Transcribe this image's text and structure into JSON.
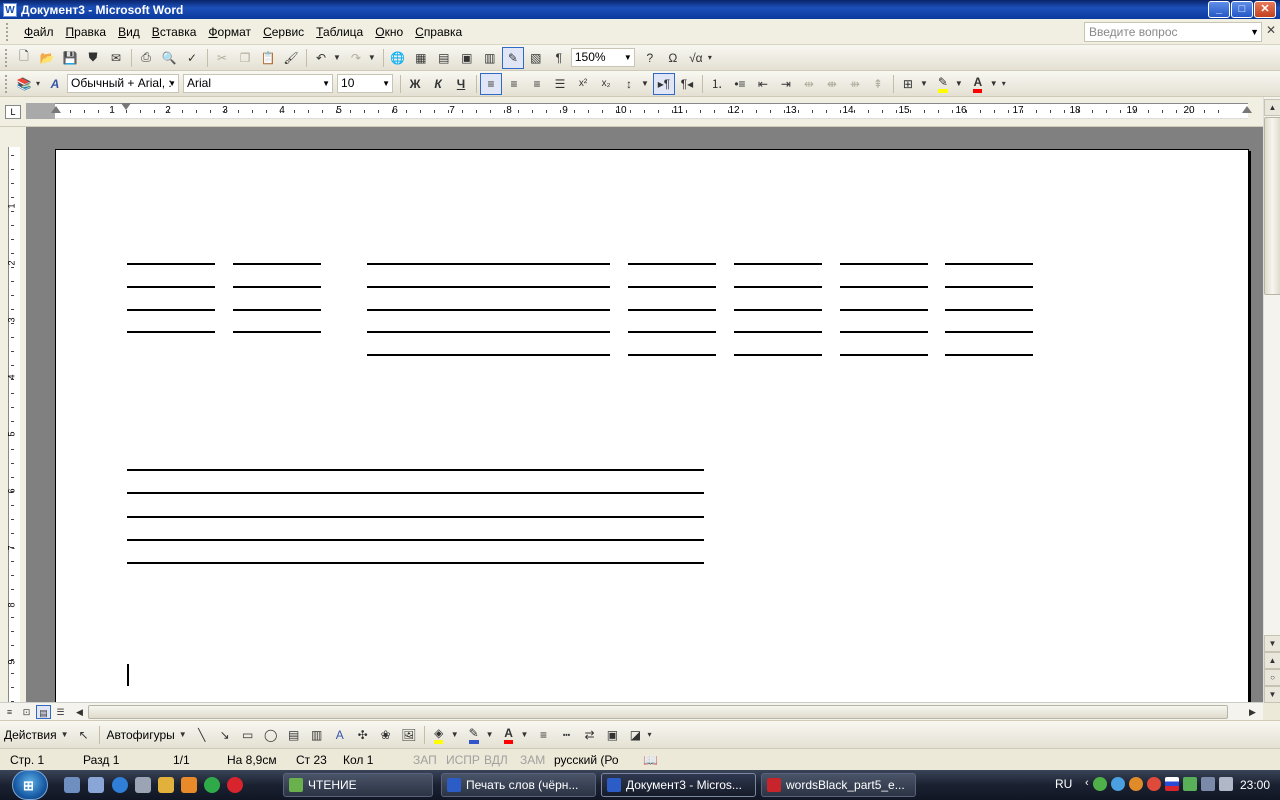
{
  "window": {
    "title": "Документ3 - Microsoft Word",
    "app_icon": "W"
  },
  "menu": {
    "items": [
      "Файл",
      "Правка",
      "Вид",
      "Вставка",
      "Формат",
      "Сервис",
      "Таблица",
      "Окно",
      "Справка"
    ],
    "help_placeholder": "Введите вопрос"
  },
  "toolbar_standard": {
    "zoom": "150%"
  },
  "toolbar_format": {
    "style": "Обычный + Arial, :",
    "font": "Arial",
    "size": "10",
    "bold": "Ж",
    "italic": "К",
    "underline": "Ч"
  },
  "ruler": {
    "corner": "L",
    "numbers": [
      "1",
      "1",
      "2",
      "3",
      "4",
      "5",
      "6",
      "7",
      "8",
      "9",
      "10",
      "11",
      "12",
      "13",
      "14",
      "15",
      "16",
      "17",
      "18",
      "19",
      "20"
    ]
  },
  "vruler": {
    "numbers": [
      "1",
      "2",
      "3",
      "4",
      "5",
      "6",
      "7",
      "8",
      "9"
    ]
  },
  "drawing": {
    "actions": "Действия",
    "autoshapes": "Автофигуры"
  },
  "status": {
    "page": "Стр. 1",
    "section": "Разд 1",
    "pages": "1/1",
    "at": "На 8,9см",
    "line": "Ст 23",
    "col": "Кол 1",
    "rec": "ЗАП",
    "trk": "ИСПР",
    "ext": "ВДЛ",
    "ovr": "ЗАМ",
    "lang": "русский (Ро"
  },
  "taskbar": {
    "tasks": [
      "ЧТЕНИЕ",
      "Печать слов (чёрн...",
      "Документ3 - Micros...",
      "wordsBlack_part5_e..."
    ],
    "lang": "RU",
    "clock": "23:00"
  },
  "colors": {
    "title_bar": "#0a3a9e",
    "doc_background": "#808080",
    "page": "#ffffff",
    "highlight": "#ffff00",
    "font_color": "#ff0000"
  }
}
